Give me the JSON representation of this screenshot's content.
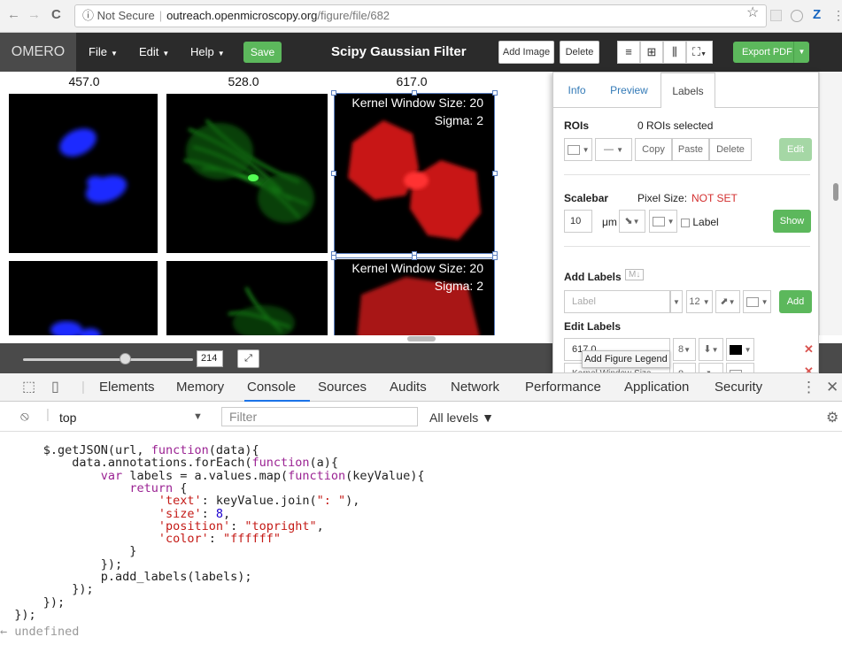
{
  "browser": {
    "back": "←",
    "forward": "→",
    "reload": "C",
    "info_icon": "ⓘ",
    "not_secure": "Not Secure",
    "domain": "outreach.openmicroscopy.org",
    "path": "/figure/file/682",
    "star": "☆"
  },
  "toolbar": {
    "brand": "OMERO",
    "menus": [
      "File",
      "Edit",
      "Help"
    ],
    "save": "Save",
    "title": "Scipy Gaussian Filter",
    "add_image": "Add Image",
    "delete": "Delete",
    "export": "Export PDF"
  },
  "canvas": {
    "labels": [
      "457.0",
      "528.0",
      "617.0"
    ],
    "kernel_text": "Kernel Window Size: 20",
    "sigma_text": "Sigma: 2"
  },
  "zoom": {
    "value": "214",
    "slider_fraction": 0.6
  },
  "right_panel": {
    "tabs": [
      "Info",
      "Preview",
      "Labels"
    ],
    "rois": {
      "title": "ROIs",
      "selected": "0 ROIs selected",
      "copy": "Copy",
      "paste": "Paste",
      "delete": "Delete",
      "edit": "Edit"
    },
    "scalebar": {
      "title": "Scalebar",
      "pixel_size_label": "Pixel Size:",
      "pixel_size_value": "NOT SET",
      "length": "10",
      "unit": "μm",
      "label": "Label",
      "show": "Show"
    },
    "add_labels": {
      "title": "Add Labels",
      "badge": "M↓",
      "placeholder": "Label",
      "size": "12",
      "add": "Add"
    },
    "edit_labels": {
      "title": "Edit Labels",
      "row1": "617.0",
      "row2": "Kernel Window Size...",
      "size": "8"
    },
    "tooltip": "Add Figure Legend"
  },
  "devtools": {
    "tabs": [
      "Elements",
      "Memory",
      "Console",
      "Sources",
      "Audits",
      "Network",
      "Performance",
      "Application",
      "Security"
    ],
    "context": "top",
    "filter_placeholder": "Filter",
    "levels": "All levels ▼",
    "result": "undefined"
  },
  "colors": {
    "accent_green": "#5cb85c",
    "toolbar": "#2b2b2b",
    "selection": "#5b7fbf",
    "devtools_active": "#1a73e8"
  }
}
